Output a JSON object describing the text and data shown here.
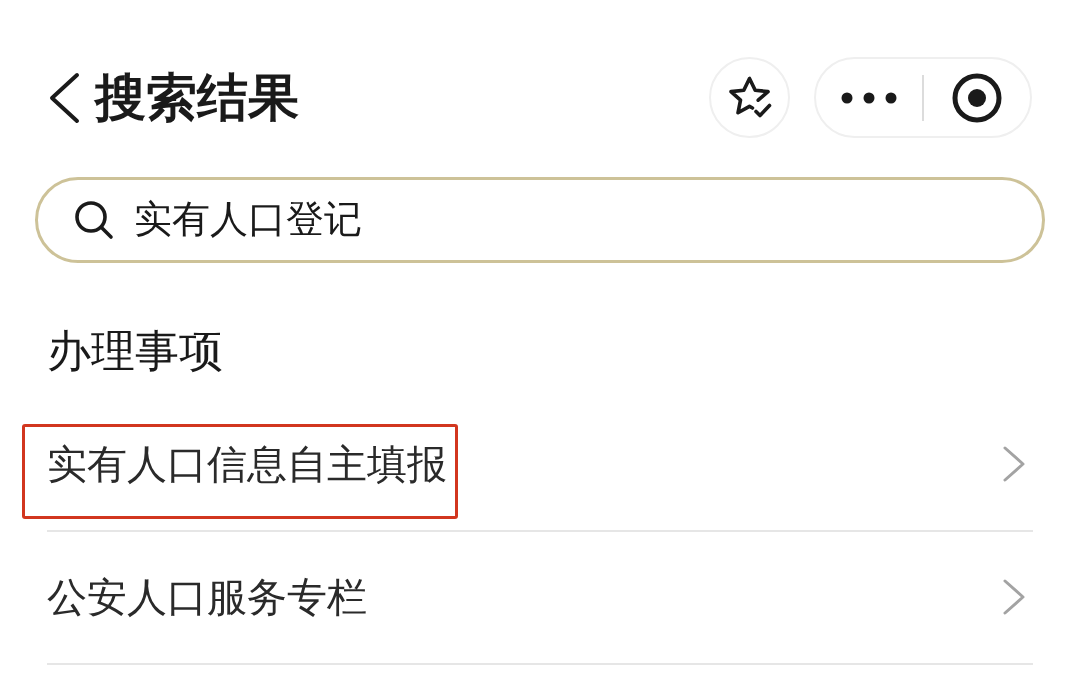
{
  "header": {
    "title": "搜索结果"
  },
  "search": {
    "value": "实有人口登记"
  },
  "section": {
    "title": "办理事项"
  },
  "items": [
    {
      "label": "实有人口信息自主填报",
      "highlighted": true
    },
    {
      "label": "公安人口服务专栏",
      "highlighted": false
    }
  ]
}
